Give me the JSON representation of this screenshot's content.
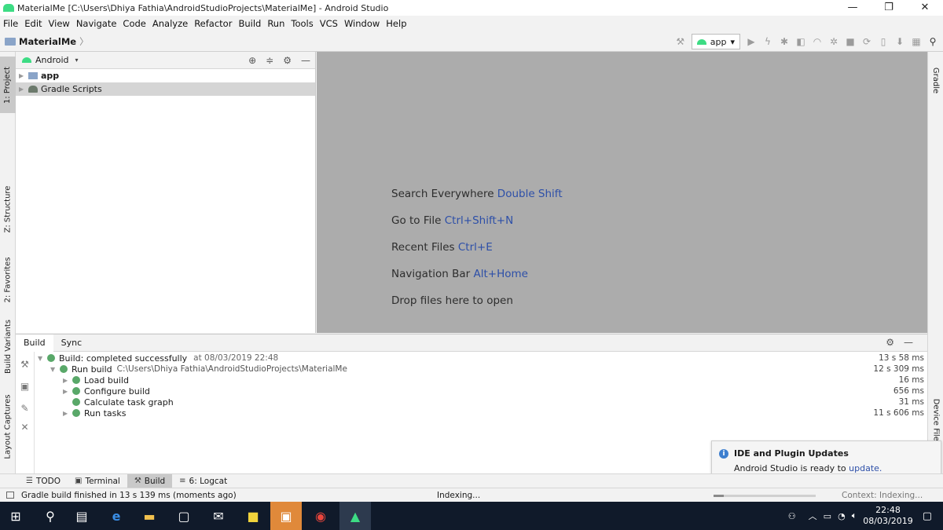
{
  "window": {
    "title": "MaterialMe [C:\\Users\\Dhiya Fathia\\AndroidStudioProjects\\MaterialMe] - Android Studio",
    "minimize": "—",
    "maximize": "❐",
    "close": "✕"
  },
  "menu": [
    "File",
    "Edit",
    "View",
    "Navigate",
    "Code",
    "Analyze",
    "Refactor",
    "Build",
    "Run",
    "Tools",
    "VCS",
    "Window",
    "Help"
  ],
  "breadcrumb": {
    "project": "MaterialMe",
    "chevron": "〉"
  },
  "toolbar": {
    "run_config": "app",
    "run_config_arrow": "▾"
  },
  "left_tabs": {
    "project": "1: Project",
    "structure": "Z: Structure",
    "favorites": "2: Favorites",
    "build_variants": "Build Variants",
    "layout_captures": "Layout Captures"
  },
  "right_tabs": {
    "gradle": "Gradle",
    "device_file": "Device File Ex"
  },
  "project_panel": {
    "view": "Android",
    "view_arrow": "▾",
    "tree": [
      {
        "label": "app",
        "selected": false
      },
      {
        "label": "Gradle Scripts",
        "selected": true
      }
    ]
  },
  "editor_hints": [
    {
      "text": "Search Everywhere",
      "key": "Double Shift"
    },
    {
      "text": "Go to File",
      "key": "Ctrl+Shift+N"
    },
    {
      "text": "Recent Files",
      "key": "Ctrl+E"
    },
    {
      "text": "Navigation Bar",
      "key": "Alt+Home"
    },
    {
      "text": "Drop files here to open",
      "key": ""
    }
  ],
  "build_panel": {
    "tabs": [
      "Build",
      "Sync"
    ],
    "rows": [
      {
        "label": "Build: completed successfully",
        "detail": "at 08/03/2019 22:48",
        "time": "13 s 58 ms"
      },
      {
        "label": "Run build",
        "detail": "C:\\Users\\Dhiya Fathia\\AndroidStudioProjects\\MaterialMe",
        "time": "12 s 309 ms"
      },
      {
        "label": "Load build",
        "detail": "",
        "time": "16 ms"
      },
      {
        "label": "Configure build",
        "detail": "",
        "time": "656 ms"
      },
      {
        "label": "Calculate task graph",
        "detail": "",
        "time": "31 ms"
      },
      {
        "label": "Run tasks",
        "detail": "",
        "time": "11 s 606 ms"
      }
    ]
  },
  "notification": {
    "title": "IDE and Plugin Updates",
    "body": "Android Studio is ready to",
    "link": "update."
  },
  "bottom_tabs": [
    "TODO",
    "Terminal",
    "Build",
    "6: Logcat"
  ],
  "status": {
    "message": "Gradle build finished in 13 s 139 ms (moments ago)",
    "indexing": "Indexing...",
    "context": "Context: Indexing...",
    "progress": 0.1
  },
  "taskbar": {
    "time": "22:48",
    "date": "08/03/2019"
  }
}
